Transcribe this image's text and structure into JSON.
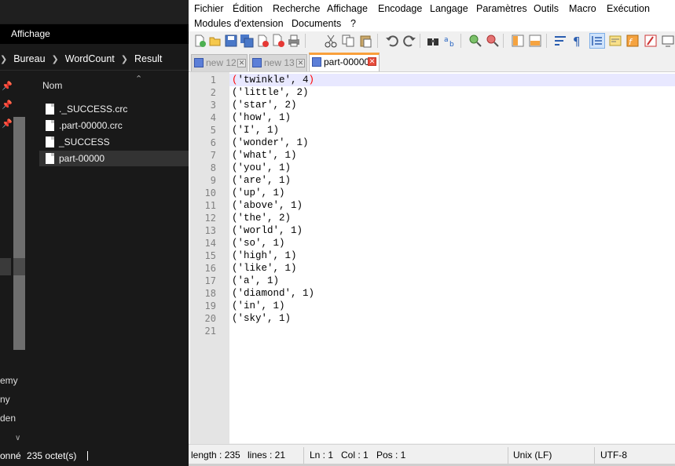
{
  "explorer": {
    "ribbon_tab": "Affichage",
    "breadcrumb": [
      "Bureau",
      "WordCount",
      "Result"
    ],
    "column_header": "Nom",
    "files": [
      {
        "name": "._SUCCESS.crc"
      },
      {
        "name": ".part-00000.crc"
      },
      {
        "name": "_SUCCESS"
      },
      {
        "name": "part-00000",
        "selected": true
      }
    ],
    "nav_fragments": [
      "emy",
      "ny",
      "den"
    ],
    "status": {
      "text_fragment": "onné",
      "size": "235 octet(s)"
    }
  },
  "npp": {
    "menu": [
      "Fichier",
      "Édition",
      "Recherche",
      "Affichage",
      "Encodage",
      "Langage",
      "Paramètres",
      "Outils",
      "Macro",
      "Exécution",
      "Modules d'extension",
      "Documents",
      "?"
    ],
    "toolbar_icons": [
      "new-icon",
      "open-icon",
      "save-icon",
      "save-all-icon",
      "close-icon",
      "close-all-icon",
      "print-icon",
      "cut-icon",
      "copy-icon",
      "paste-icon",
      "undo-icon",
      "redo-icon",
      "find-icon",
      "replace-icon",
      "zoom-in-icon",
      "zoom-out-icon",
      "sync-v-icon",
      "sync-h-icon",
      "wrap-icon",
      "show-all-chars-icon",
      "indent-guide-icon",
      "doc-map-icon",
      "function-list-icon",
      "folder-workspace-icon",
      "monitor-icon"
    ],
    "tabs": [
      {
        "label": "new 12",
        "active": false
      },
      {
        "label": "new 13",
        "active": false
      },
      {
        "label": "part-00000",
        "active": true
      }
    ],
    "lines": [
      "('twinkle', 4)",
      "('little', 2)",
      "('star', 2)",
      "('how', 1)",
      "('I', 1)",
      "('wonder', 1)",
      "('what', 1)",
      "('you', 1)",
      "('are', 1)",
      "('up', 1)",
      "('above', 1)",
      "('the', 2)",
      "('world', 1)",
      "('so', 1)",
      "('high', 1)",
      "('like', 1)",
      "('a', 1)",
      "('diamond', 1)",
      "('in', 1)",
      "('sky', 1)",
      ""
    ],
    "status": {
      "length": "length : 235",
      "lines": "lines : 21",
      "ln": "Ln : 1",
      "col": "Col : 1",
      "pos": "Pos : 1",
      "eol": "Unix (LF)",
      "encoding": "UTF-8"
    }
  }
}
